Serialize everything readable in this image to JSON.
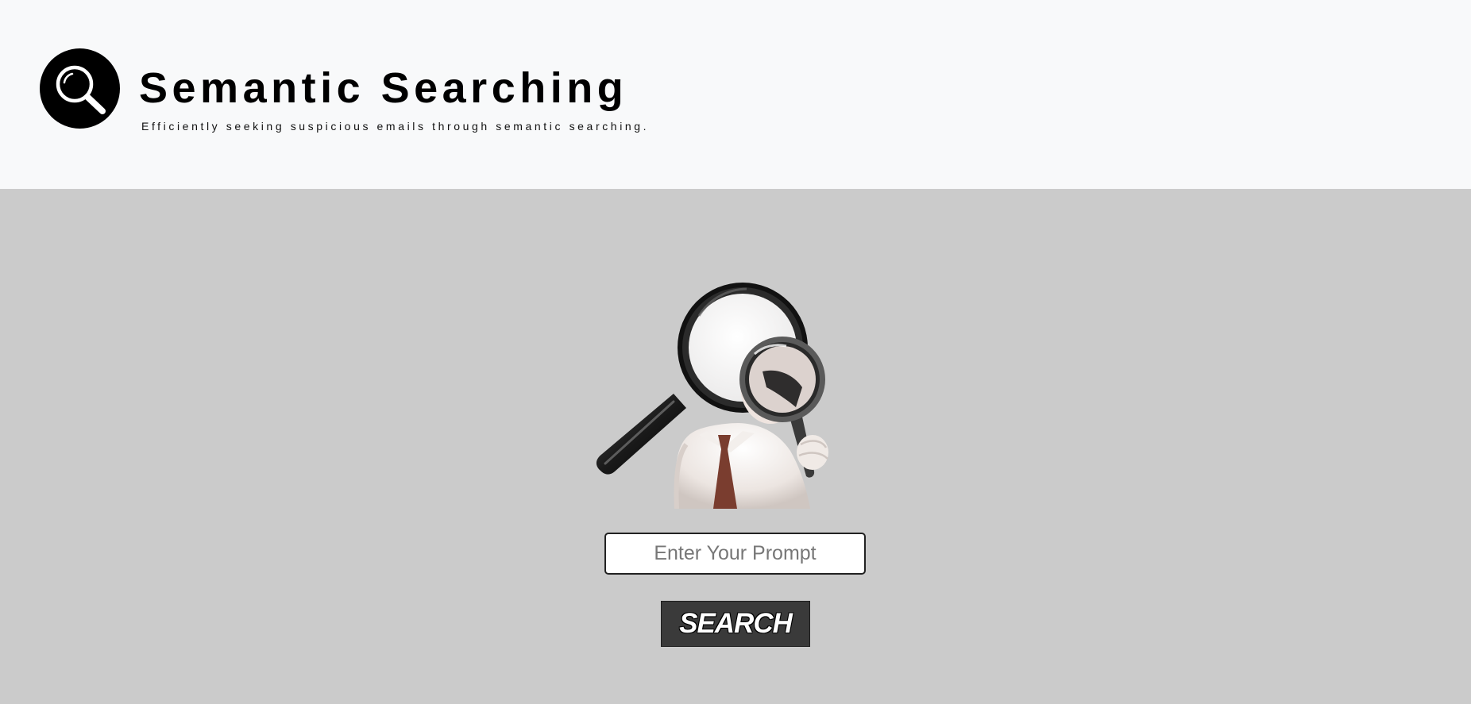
{
  "header": {
    "logo_icon": "magnifier-icon",
    "title": "Semantic Searching",
    "subtitle": "Efficiently seeking suspicious emails through semantic searching."
  },
  "main": {
    "illustration": "detective-with-magnifying-glasses-illustration",
    "prompt": {
      "value": "",
      "placeholder": "Enter Your Prompt"
    },
    "search_button_label": "SEARCH"
  },
  "colors": {
    "header_bg": "#f8f9fa",
    "main_bg": "#cbcbcb",
    "button_bg": "#3a3a3a"
  }
}
